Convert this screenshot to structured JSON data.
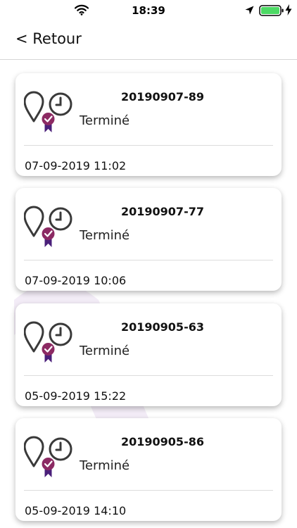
{
  "status_bar": {
    "time": "18:39"
  },
  "nav": {
    "back_label": "< Retour"
  },
  "orders": [
    {
      "id": "20190907-89",
      "status": "Terminé",
      "date": "07-09-2019 11:02"
    },
    {
      "id": "20190907-77",
      "status": "Terminé",
      "date": "07-09-2019 10:06"
    },
    {
      "id": "20190905-63",
      "status": "Terminé",
      "date": "05-09-2019 15:22"
    },
    {
      "id": "20190905-86",
      "status": "Terminé",
      "date": "05-09-2019 14:10"
    }
  ],
  "colors": {
    "icon_dark": "#3a3a3a",
    "badge": "#8c2a63",
    "ribbon": "#4a1f7a",
    "watermark": "#efe6f4"
  }
}
